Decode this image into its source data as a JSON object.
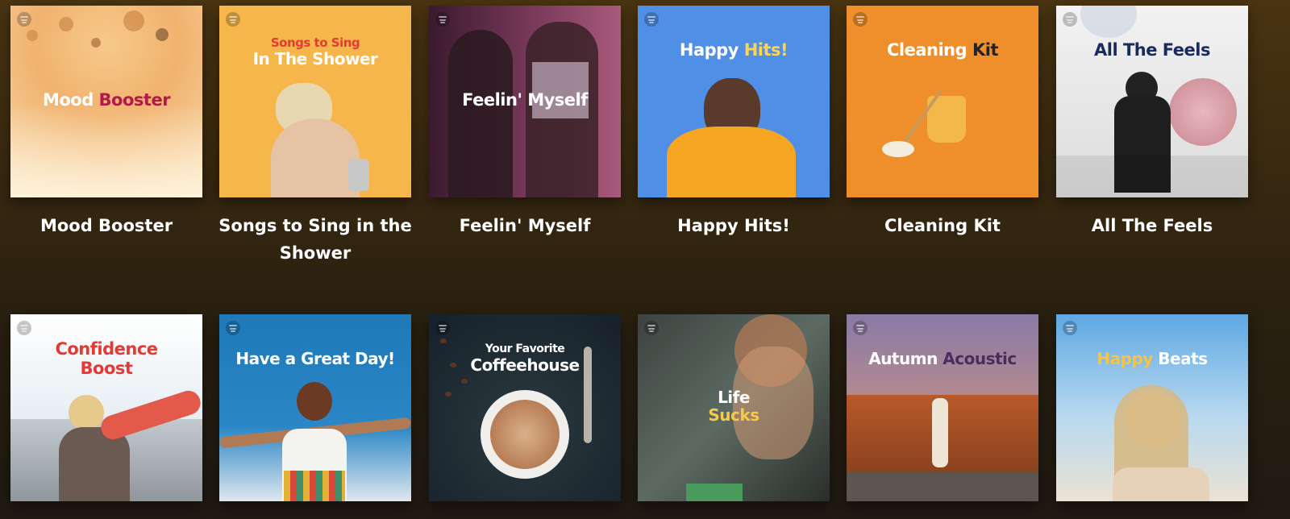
{
  "playlists": [
    {
      "title": "Mood Booster",
      "cover": {
        "word1": "Mood ",
        "word2": "Booster",
        "sub": "",
        "color1": "#ffffff",
        "color2": "#c2185b"
      }
    },
    {
      "title": "Songs to Sing in the Shower",
      "cover": {
        "word1": "",
        "word2": "In The Shower",
        "sub": "Songs to Sing",
        "color1": "#ffffff",
        "color2": "#ffffff",
        "subcolor": "#e53935"
      }
    },
    {
      "title": "Feelin' Myself",
      "cover": {
        "word1": "Feelin' ",
        "word2": "Myself",
        "sub": "",
        "color1": "#ffffff",
        "color2": "#ffffff"
      }
    },
    {
      "title": "Happy Hits!",
      "cover": {
        "word1": "Happy ",
        "word2": "Hits!",
        "sub": "",
        "color1": "#ffffff",
        "color2": "#ffd54f"
      }
    },
    {
      "title": "Cleaning Kit",
      "cover": {
        "word1": "Cleaning ",
        "word2": "Kit",
        "sub": "",
        "color1": "#ffffff",
        "color2": "#222222"
      }
    },
    {
      "title": "All The Feels",
      "cover": {
        "word1": "All The ",
        "word2": "Feels",
        "sub": "",
        "color1": "#1a2a5e",
        "color2": "#1a2a5e"
      }
    },
    {
      "title": "",
      "cover": {
        "word1": "Confidence",
        "word2": "Boost",
        "sub": "",
        "color1": "#e53935",
        "color2": "#e53935"
      }
    },
    {
      "title": "",
      "cover": {
        "word1": "Have a Great Day!",
        "word2": "",
        "sub": "",
        "color1": "#ffffff",
        "color2": "#ffffff"
      }
    },
    {
      "title": "",
      "cover": {
        "word1": "",
        "word2": "Coffeehouse",
        "sub": "Your Favorite",
        "color1": "#ffffff",
        "color2": "#ffffff",
        "subcolor": "#ffffff"
      }
    },
    {
      "title": "",
      "cover": {
        "word1": "Life",
        "word2": "Sucks",
        "sub": "",
        "color1": "#ffffff",
        "color2": "#f7c948"
      }
    },
    {
      "title": "",
      "cover": {
        "word1": "Autumn ",
        "word2": "Acoustic",
        "sub": "",
        "color1": "#ffffff",
        "color2": "#4a2d5e"
      }
    },
    {
      "title": "",
      "cover": {
        "word1": "Happy ",
        "word2": "Beats",
        "sub": "",
        "color1": "#f6c344",
        "color2": "#ffffff"
      }
    }
  ]
}
